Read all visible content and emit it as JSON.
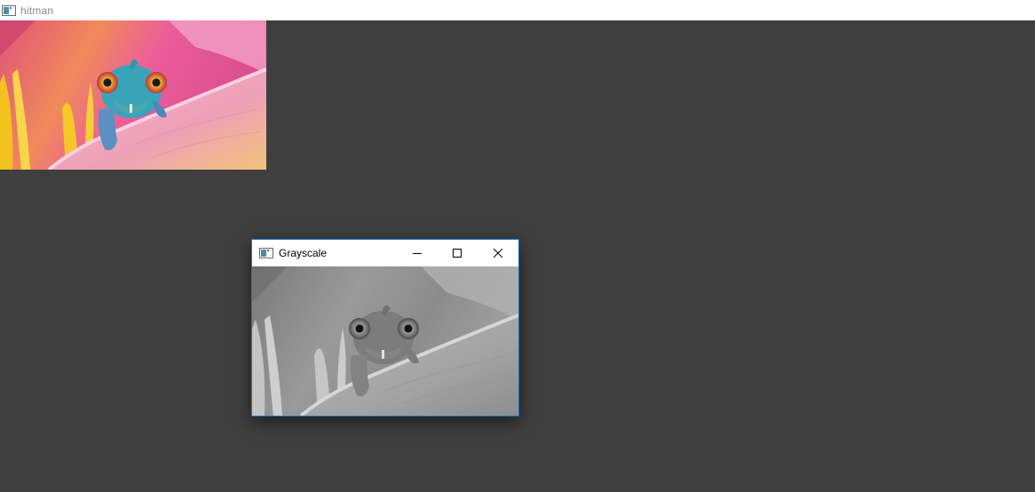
{
  "main_window": {
    "title": "hitman",
    "icon": "opencv-window-icon",
    "image": {
      "subject": "chameleon-on-flower",
      "mode": "color"
    }
  },
  "child_window": {
    "title": "Grayscale",
    "icon": "opencv-window-icon",
    "controls": {
      "minimize": "minimize-icon",
      "maximize": "maximize-icon",
      "close": "close-icon"
    },
    "image": {
      "subject": "chameleon-on-flower",
      "mode": "grayscale"
    },
    "border_color": "#1979ca"
  },
  "colors": {
    "desktop_background": "#3f3f3f",
    "titlebar": "#ffffff",
    "main_title_text": "#8a8a8a"
  }
}
